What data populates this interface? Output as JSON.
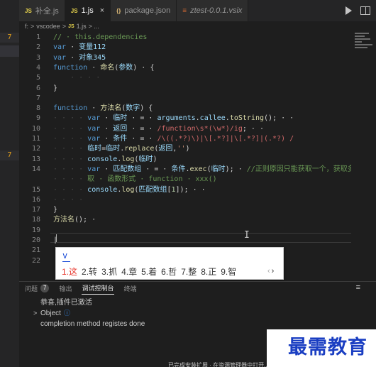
{
  "tabs": [
    {
      "icon": "JS",
      "label": "补全.js",
      "italic": false,
      "active": false
    },
    {
      "icon": "JS",
      "label": "1.js",
      "italic": false,
      "active": true
    },
    {
      "icon": "{}",
      "label": "package.json",
      "italic": false,
      "active": false
    },
    {
      "icon": "≡",
      "label": "ztest-0.0.1.vsix",
      "italic": true,
      "active": false
    }
  ],
  "tab_close": "×",
  "breadcrumb": {
    "parts": [
      "f:",
      ">",
      "vscodee",
      ">"
    ],
    "file_icon": "JS",
    "file": "1.js",
    "tail": "> ..."
  },
  "activity_badges": [
    "7",
    "7"
  ],
  "editor": {
    "line_numbers": [
      "1",
      "2",
      "3",
      "4",
      "5",
      "6",
      "7",
      "8",
      "9",
      "10",
      "11",
      "12",
      "13",
      "14",
      "",
      "15",
      "16",
      "17",
      "18",
      "19",
      "20",
      "21",
      "22"
    ],
    "lines": [
      [
        [
          "c-cmt",
          "// · this.dependencies"
        ]
      ],
      [
        [
          "c-kw",
          "var"
        ],
        [
          "c-txt",
          " · "
        ],
        [
          "c-id",
          "变量112"
        ]
      ],
      [
        [
          "c-kw",
          "var"
        ],
        [
          "c-txt",
          " · "
        ],
        [
          "c-id",
          "对象345"
        ]
      ],
      [
        [
          "c-kw",
          "function"
        ],
        [
          "c-txt",
          " · "
        ],
        [
          "c-fn",
          "命名"
        ],
        [
          "c-txt",
          "("
        ],
        [
          "c-id",
          "参数"
        ],
        [
          "c-txt",
          ") · {"
        ]
      ],
      [
        [
          "dots",
          "    · · · ·"
        ]
      ],
      [
        [
          "c-txt",
          "}"
        ]
      ],
      [],
      [
        [
          "c-kw",
          "function"
        ],
        [
          "c-txt",
          " · "
        ],
        [
          "c-fn",
          "方法名"
        ],
        [
          "c-txt",
          "("
        ],
        [
          "c-id",
          "数字"
        ],
        [
          "c-txt",
          ") {"
        ]
      ],
      [
        [
          "dots",
          "· · · · "
        ],
        [
          "c-kw",
          "var"
        ],
        [
          "c-txt",
          " · "
        ],
        [
          "c-id",
          "临时"
        ],
        [
          "c-txt",
          " · = · "
        ],
        [
          "c-id",
          "arguments"
        ],
        [
          "c-txt",
          "."
        ],
        [
          "c-id",
          "callee"
        ],
        [
          "c-txt",
          "."
        ],
        [
          "c-fn",
          "toString"
        ],
        [
          "c-txt",
          "(); · ·"
        ]
      ],
      [
        [
          "dots",
          "· · · · "
        ],
        [
          "c-kw",
          "var"
        ],
        [
          "c-txt",
          " · "
        ],
        [
          "c-id",
          "返回"
        ],
        [
          "c-txt",
          " · = · "
        ],
        [
          "c-rx",
          "/function\\s*(\\w*)/ig"
        ],
        [
          "c-txt",
          "; · ·"
        ]
      ],
      [
        [
          "dots",
          "· · · · "
        ],
        [
          "c-kw",
          "var"
        ],
        [
          "c-txt",
          " · "
        ],
        [
          "c-id",
          "条件"
        ],
        [
          "c-txt",
          " · = · "
        ],
        [
          "c-rx",
          "/\\((.*?)\\)|\\[.*?]|\\[.*?]|(.*?) /"
        ]
      ],
      [
        [
          "dots",
          "· · · · "
        ],
        [
          "c-id",
          "临时"
        ],
        [
          "c-txt",
          "="
        ],
        [
          "c-id",
          "临时"
        ],
        [
          "c-txt",
          "."
        ],
        [
          "c-fn",
          "replace"
        ],
        [
          "c-txt",
          "("
        ],
        [
          "c-id",
          "返回"
        ],
        [
          "c-txt",
          ","
        ],
        [
          "c-str",
          "''"
        ],
        [
          "c-txt",
          ")"
        ]
      ],
      [
        [
          "dots",
          "· · · · "
        ],
        [
          "c-id",
          "console"
        ],
        [
          "c-txt",
          "."
        ],
        [
          "c-fn",
          "log"
        ],
        [
          "c-txt",
          "("
        ],
        [
          "c-id",
          "临时"
        ],
        [
          "c-txt",
          ")"
        ]
      ],
      [
        [
          "dots",
          "· · · · "
        ],
        [
          "c-kw",
          "var"
        ],
        [
          "c-txt",
          " · "
        ],
        [
          "c-id",
          "匹配数组"
        ],
        [
          "c-txt",
          " · = · "
        ],
        [
          "c-id",
          "条件"
        ],
        [
          "c-txt",
          "."
        ],
        [
          "c-fn",
          "exec"
        ],
        [
          "c-txt",
          "("
        ],
        [
          "c-id",
          "临时"
        ],
        [
          "c-txt",
          "); · "
        ],
        [
          "c-cmt",
          "//正则原因只能获取一个，获取多个需"
        ]
      ],
      [
        [
          "dots",
          "· · · · "
        ],
        [
          "c-cmt",
          "取 · 函数形式 · function · xxx()"
        ]
      ],
      [
        [
          "dots",
          "· · · · "
        ],
        [
          "c-id",
          "console"
        ],
        [
          "c-txt",
          "."
        ],
        [
          "c-fn",
          "log"
        ],
        [
          "c-txt",
          "("
        ],
        [
          "c-id",
          "匹配数组"
        ],
        [
          "c-txt",
          "["
        ],
        [
          "c-num",
          "1"
        ],
        [
          "c-txt",
          "]); · ·"
        ]
      ],
      [
        [
          "dots",
          "· · · · "
        ]
      ],
      [
        [
          "c-txt",
          "}"
        ]
      ],
      [
        [
          "c-fn",
          "方法名"
        ],
        [
          "c-txt",
          "(); ·"
        ]
      ],
      [],
      [
        [
          "c-txt",
          "|"
        ]
      ],
      [],
      []
    ]
  },
  "ime": {
    "composition": "v",
    "candidates": [
      {
        "n": "1.",
        "c": "这",
        "selected": true
      },
      {
        "n": "2.",
        "c": "转",
        "selected": false
      },
      {
        "n": "3.",
        "c": "抓",
        "selected": false
      },
      {
        "n": "4.",
        "c": "章",
        "selected": false
      },
      {
        "n": "5.",
        "c": "着",
        "selected": false
      },
      {
        "n": "6.",
        "c": "哲",
        "selected": false
      },
      {
        "n": "7.",
        "c": "整",
        "selected": false
      },
      {
        "n": "8.",
        "c": "正",
        "selected": false
      },
      {
        "n": "9.",
        "c": "智",
        "selected": false
      }
    ],
    "prev": "‹",
    "next": "›"
  },
  "panel": {
    "tabs": [
      {
        "label": "问题",
        "count": "7",
        "active": false
      },
      {
        "label": "输出",
        "count": "",
        "active": false
      },
      {
        "label": "调试控制台",
        "count": "",
        "active": true
      },
      {
        "label": "终端",
        "count": "",
        "active": false
      }
    ],
    "menu": "≡",
    "output": [
      {
        "chevron": "",
        "text": "恭喜,插件已激活",
        "info": ""
      },
      {
        "chevron": ">",
        "text": "Object",
        "info": "ⓘ"
      },
      {
        "chevron": "",
        "text": "completion method registes done",
        "info": ""
      }
    ],
    "status_partial": "已完成安装扩展 · 在资源管理器中打开..."
  },
  "watermark": "最需教育"
}
